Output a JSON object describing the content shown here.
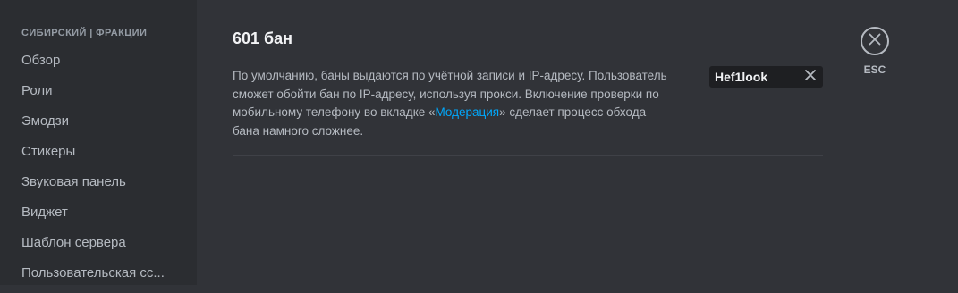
{
  "sidebar": {
    "header": "СИБИРСКИЙ | ФРАКЦИИ",
    "items": [
      {
        "label": "Обзор"
      },
      {
        "label": "Роли"
      },
      {
        "label": "Эмодзи"
      },
      {
        "label": "Стикеры"
      },
      {
        "label": "Звуковая панель"
      },
      {
        "label": "Виджет"
      },
      {
        "label": "Шаблон сервера"
      },
      {
        "label": "Пользовательская сс..."
      }
    ]
  },
  "main": {
    "title": "601 бан",
    "description_before": "По умолчанию, баны выдаются по учётной записи и IP-адресу. Пользователь сможет обойти бан по IP-адресу, используя прокси. Включение проверки по мобильному телефону во вкладке «",
    "description_link": "Модерация",
    "description_after": "» сделает процесс обхода бана намного сложнее.",
    "search_chip": {
      "value": "Hef1look"
    }
  },
  "close": {
    "label": "ESC",
    "icon": "close-icon"
  },
  "colors": {
    "background": "#313338",
    "sidebar": "#2b2d31",
    "link": "#00a8fc",
    "chip": "#1e1f22"
  }
}
